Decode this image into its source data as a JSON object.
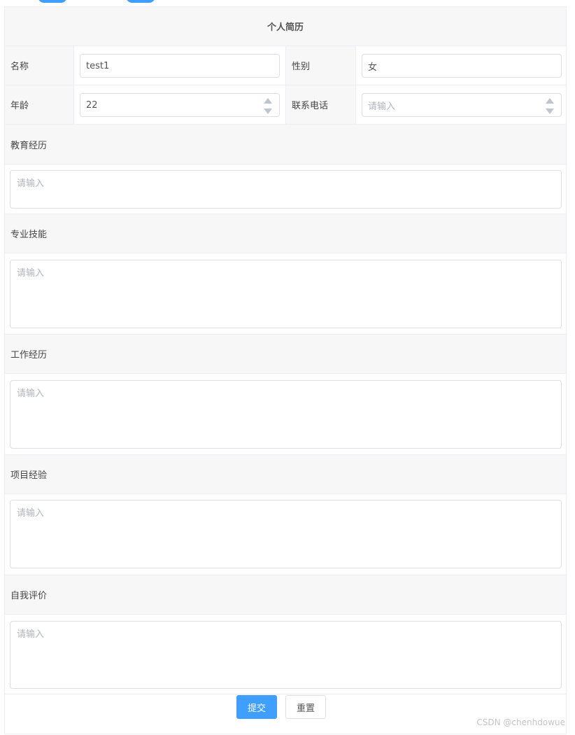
{
  "form": {
    "title": "个人简历",
    "name_label": "名称",
    "name_value": "test1",
    "gender_label": "性别",
    "gender_value": "女",
    "age_label": "年龄",
    "age_value": "22",
    "phone_label": "联系电话",
    "phone_placeholder": "请输入",
    "sections": [
      {
        "label": "教育经历",
        "placeholder": "请输入"
      },
      {
        "label": "专业技能",
        "placeholder": "请输入"
      },
      {
        "label": "工作经历",
        "placeholder": "请输入"
      },
      {
        "label": "项目经验",
        "placeholder": "请输入"
      },
      {
        "label": "自我评价",
        "placeholder": "请输入"
      }
    ],
    "submit_label": "提交",
    "reset_label": "重置"
  },
  "watermark": "CSDN @chenhdowue",
  "colors": {
    "primary": "#409eff",
    "border": "#ebeef5",
    "header_bg": "#f7f7f7"
  }
}
